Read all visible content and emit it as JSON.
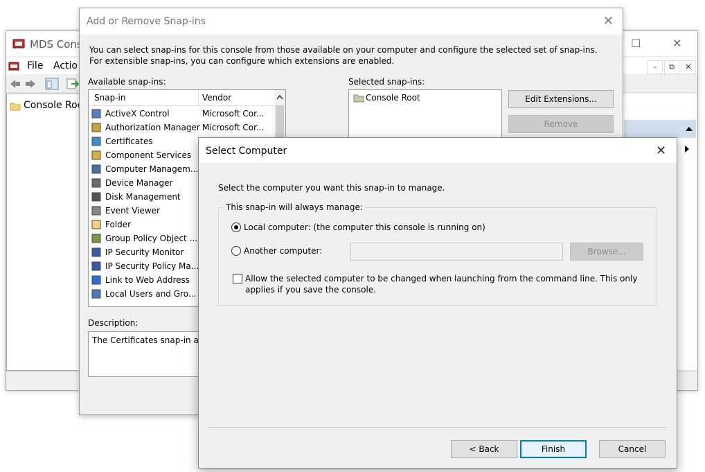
{
  "mds_window": {
    "title": "MDS Conso",
    "menu": [
      "File",
      "Actio"
    ],
    "tree_item": "Console Roo",
    "controls": {
      "maximize": "☐",
      "close": "✕",
      "mdi_min": "–",
      "mdi_restore": "⧉",
      "mdi_close": "✕"
    }
  },
  "snapins_dialog": {
    "title": "Add or Remove Snap-ins",
    "close": "✕",
    "intro": "You can select snap-ins for this console from those available on your computer and configure the selected set of snap-ins. For extensible snap-ins, you can configure which extensions are enabled.",
    "available_label": "Available snap-ins:",
    "columns": {
      "snapin": "Snap-in",
      "vendor": "Vendor"
    },
    "snapins": [
      {
        "name": "ActiveX Control",
        "vendor": "Microsoft Cor...",
        "icon": "activex-icon"
      },
      {
        "name": "Authorization Manager",
        "vendor": "Microsoft Cor...",
        "icon": "authorization-icon"
      },
      {
        "name": "Certificates",
        "vendor": "",
        "icon": "certificates-icon"
      },
      {
        "name": "Component Services",
        "vendor": "",
        "icon": "component-services-icon"
      },
      {
        "name": "Computer Managem...",
        "vendor": "",
        "icon": "computer-management-icon"
      },
      {
        "name": "Device Manager",
        "vendor": "",
        "icon": "device-manager-icon"
      },
      {
        "name": "Disk Management",
        "vendor": "",
        "icon": "disk-icon"
      },
      {
        "name": "Event Viewer",
        "vendor": "",
        "icon": "event-viewer-icon"
      },
      {
        "name": "Folder",
        "vendor": "",
        "icon": "folder-icon"
      },
      {
        "name": "Group Policy Object ...",
        "vendor": "",
        "icon": "group-policy-icon"
      },
      {
        "name": "IP Security Monitor",
        "vendor": "",
        "icon": "ip-security-icon"
      },
      {
        "name": "IP Security Policy Ma...",
        "vendor": "",
        "icon": "ip-security-policy-icon"
      },
      {
        "name": "Link to Web Address",
        "vendor": "",
        "icon": "web-link-icon"
      },
      {
        "name": "Local Users and Gro...",
        "vendor": "",
        "icon": "users-icon"
      }
    ],
    "selected_label": "Selected snap-ins:",
    "selected_items": [
      "Console Root"
    ],
    "edit_extensions": "Edit Extensions...",
    "remove": "Remove",
    "description_label": "Description:",
    "description_text": "The Certificates snap-in all"
  },
  "select_computer": {
    "title": "Select Computer",
    "close": "✕",
    "prompt": "Select the computer you want this snap-in to manage.",
    "group_label": "This snap-in will always manage:",
    "local_option": "Local computer:  (the computer this console is running on)",
    "local_checked": true,
    "another_option": "Another computer:",
    "another_value": "",
    "browse": "Browse...",
    "allow_change_line1": "Allow the selected computer to be changed when launching from the command line.  This only",
    "allow_change_line2": "applies if you save the console.",
    "allow_change_checked": false,
    "back": "< Back",
    "finish": "Finish",
    "cancel": "Cancel"
  }
}
